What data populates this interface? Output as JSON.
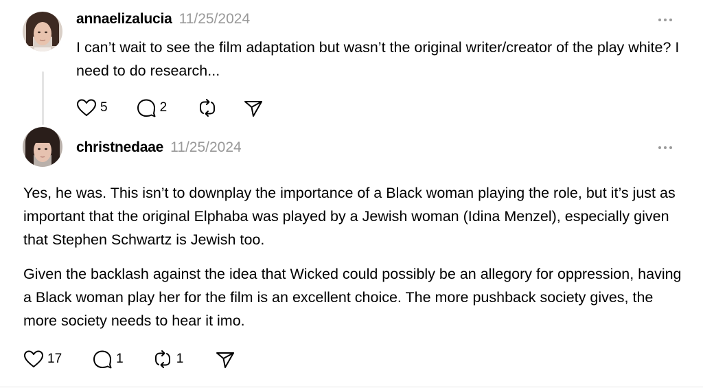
{
  "posts": [
    {
      "username": "annaelizalucia",
      "timestamp": "11/25/2024",
      "text": [
        "I can’t wait to see the film adaptation but wasn’t the original writer/creator of the play white? I need to do research..."
      ],
      "likes": "5",
      "replies": "2",
      "reposts": "",
      "icons": [
        "more-icon",
        "heart-icon",
        "comment-icon",
        "repost-icon",
        "share-icon"
      ]
    },
    {
      "username": "christnedaae",
      "timestamp": "11/25/2024",
      "text": [
        "Yes, he was. This isn’t to downplay the importance of a Black woman playing the role, but it’s just as important that the original Elphaba was played by a Jewish woman (Idina Menzel), especially given that Stephen Schwartz is Jewish too.",
        "Given the backlash against the idea that Wicked could possibly be an allegory for oppression, having a Black woman play her for the film is an excellent choice. The more pushback society gives, the more society needs to hear it imo."
      ],
      "likes": "17",
      "replies": "1",
      "reposts": "1",
      "icons": [
        "more-icon",
        "heart-icon",
        "comment-icon",
        "repost-icon",
        "share-icon"
      ]
    }
  ],
  "colors": {
    "text": "#000000",
    "timestamp": "#999999",
    "thread_line": "#e4e4e4"
  }
}
